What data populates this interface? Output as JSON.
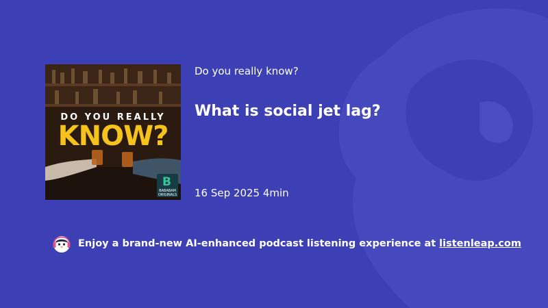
{
  "cover": {
    "line1": "DO YOU REALLY",
    "line2": "KNOW?",
    "badge_mark": "B",
    "badge_line1": "BABABAM",
    "badge_line2": "ORIGINALS"
  },
  "show_title": "Do you really know?",
  "episode_title": "What is social jet lag?",
  "meta": {
    "date": "16 Sep 2025",
    "duration": "4min"
  },
  "footer": {
    "icon": "penguin-headphones-icon",
    "text": "Enjoy a brand-new AI-enhanced podcast listening experience at",
    "link": "listenleap.com"
  },
  "colors": {
    "background": "#3d3fb4",
    "watermark": "#4a4dc1",
    "cover_title_accent": "#f6c21c",
    "badge_bg": "#183c46",
    "badge_accent": "#35c89a"
  }
}
